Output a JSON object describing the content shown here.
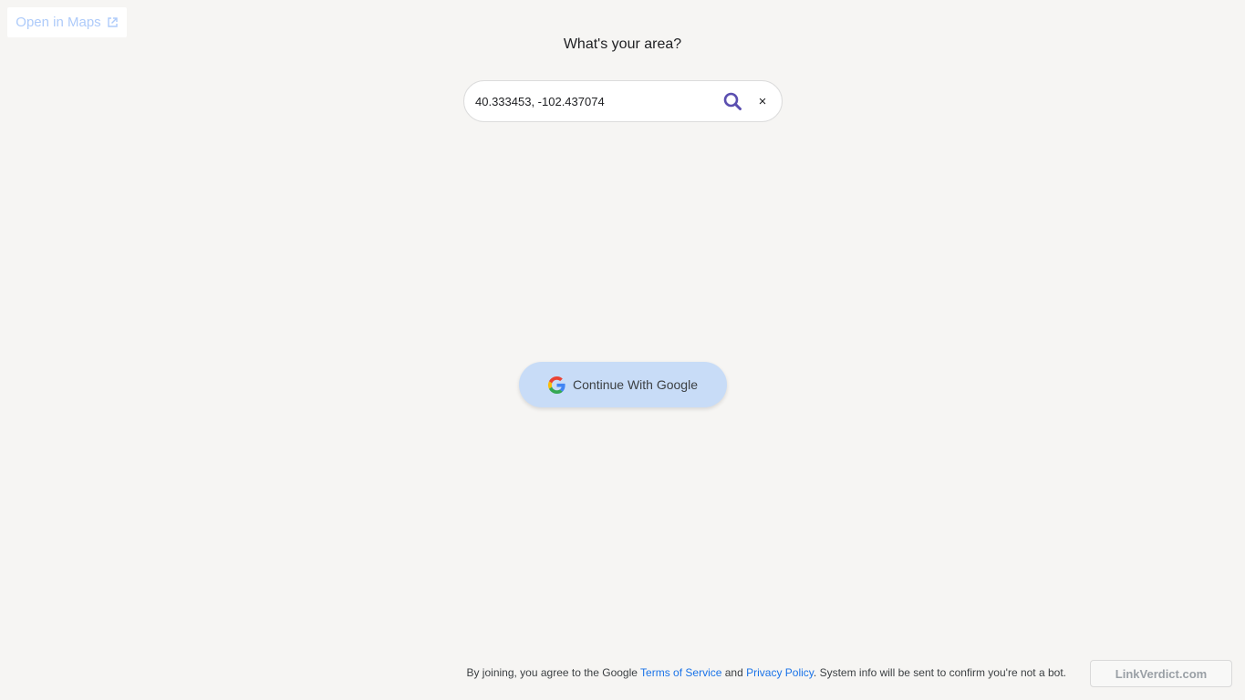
{
  "open_maps": {
    "label": "Open in Maps",
    "icon": "external-link-icon"
  },
  "question": "What's your area?",
  "search": {
    "value": "40.333453, -102.437074",
    "search_icon": "search-icon",
    "clear_label": "×"
  },
  "google_button": {
    "label": "Continue With Google",
    "icon": "google-g-icon"
  },
  "footer": {
    "prefix": "By joining, you agree to the Google ",
    "terms_label": "Terms of Service",
    "and": " and ",
    "privacy_label": "Privacy Policy",
    "suffix": ". System info will be sent to confirm you're not a bot."
  },
  "brand": {
    "label": "LinkVerdict.com"
  },
  "colors": {
    "background": "#f6f5f3",
    "accent_search": "#5b4fb0",
    "link": "#1a73e8",
    "google_button_bg": "#c8dcf7",
    "open_maps_text": "#aecbfa"
  }
}
